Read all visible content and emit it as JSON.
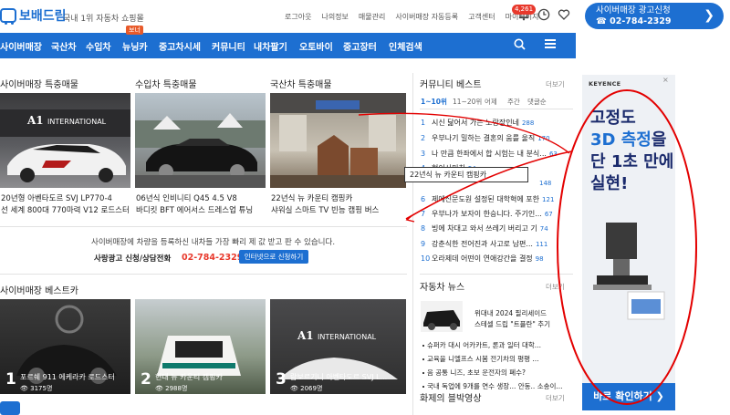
{
  "header": {
    "logo_text": "보배드림",
    "tagline": "국내 1위 자동차 쇼핑몰",
    "top_links": [
      "로그아웃",
      "나의정보",
      "매물관리",
      "사이버매장 자동등록",
      "고객센터",
      "마이페이지"
    ],
    "notification_badge": "4,261",
    "ad_cta": {
      "line1": "사이버매장 광고신청",
      "line2": "02-784-2329",
      "chevron": "❯"
    }
  },
  "nav": {
    "items": [
      "사이버매장",
      "국산차",
      "수입차",
      "뉴닝카",
      "중고차시세",
      "커뮤니티",
      "내차팔기",
      "오토바이",
      "중고장터",
      "인체검색"
    ],
    "badge": "보너"
  },
  "sections": {
    "cyber": {
      "title": "사이버매장 특충매물",
      "caption_line1": "20년형 아벤타도르 SVJ LP770-4",
      "caption_line2": "선 세계 800대 770마력 V12 로드스터",
      "sign_text": "INTERNATIONAL"
    },
    "import": {
      "title": "수입차 특충매물",
      "caption_line1": "06년식 인비니티 Q45 4.5 V8",
      "caption_line2": "바디킷 BFT 에어서스 드레스업 튜닝"
    },
    "domestic": {
      "title": "국산차 특충매물",
      "caption_line1": "22년식 뉴 카운티 캠핑카",
      "caption_line2": "샤워실 스마트 TV 빈능 캠핑 버스"
    }
  },
  "info": {
    "line1": "사이버매장에 차량을 등록하신 내차들 가장 빠리 제 값 받고 판 수 있습니다.",
    "line2": "사랑광고 신청/상담전화",
    "phone": "02-784-2329",
    "button": "인터넷으로 신청하기"
  },
  "community": {
    "title": "커뮤니티 베스트",
    "more": "더보기",
    "tabs": [
      "1~10위",
      "11~20위",
      "어제",
      "주간",
      "댓글순"
    ],
    "rows": [
      {
        "num": "1",
        "text": "시신 닮어서 가는 노랑장인네",
        "count": "288"
      },
      {
        "num": "2",
        "text": "우부나기 밀하는 결혼의 움를 울직",
        "count": "170"
      },
      {
        "num": "3",
        "text": "나 만큼 한좌에서 합 시험는 내 분식...",
        "count": "63"
      },
      {
        "num": "4",
        "text": "현이사미치",
        "count": "54"
      },
      {
        "num": "5",
        "text": "",
        "count": "148"
      },
      {
        "num": "6",
        "text": "제에신문도원 설정된 대학혁에 포한",
        "count": "121"
      },
      {
        "num": "7",
        "text": "우부나가 보자이 한승니다. 주기인...",
        "count": "67"
      },
      {
        "num": "8",
        "text": "빙에 차대고 와서 쓰레기 버리고 기",
        "count": "74"
      },
      {
        "num": "9",
        "text": "강춘식한 전어진과 사고로 남편...",
        "count": "111"
      },
      {
        "num": "10",
        "text": "오라제데 어떤이 연애강간을 결정",
        "count": "98"
      }
    ]
  },
  "tooltip": "22년식 뉴 카운티 캠핑카",
  "best": {
    "title": "사이버매장 베스트카",
    "items": [
      {
        "num": "1",
        "title": "포르쉐 911 에케라카 로드스터",
        "views": "3175명"
      },
      {
        "num": "2",
        "title": "현대 뉴 카운티 캠핑카",
        "views": "2988명"
      },
      {
        "num": "3",
        "title": "람보르기니 아벤타도르 SVJ L...",
        "views": "2069명"
      }
    ]
  },
  "news": {
    "title": "자동차 뉴스",
    "more": "더보기",
    "feature_line1": "위대내 2024 필리세이드",
    "feature_line2": "스테셀 드립 \"트플란\" 추기",
    "rows": [
      "슈퍼카 대시 어카카트, 론과 일터 대학...",
      "교육을 니엘프스 시봄 전기차의 평평 ...",
      "음 공통 니즈, 초보 운전자의 폐수?",
      "국내 독업에 9개를 연수 생장... 안동.. 소송이..."
    ]
  },
  "highlight": {
    "title": "화제의 블박영상",
    "more": "더보기"
  },
  "ad": {
    "brand": "KEYENCE",
    "headline1": "고정도",
    "headline2_blue": "3D 측정",
    "headline2_rest": "을",
    "headline3": "단 1초 만에",
    "headline4": "실현!",
    "cta": "바로 확인하기 ❯",
    "close_label": "×"
  },
  "colors": {
    "brand_blue": "#1d6fd1",
    "accent_red": "#e8392c",
    "annotation_red": "#e30000"
  }
}
